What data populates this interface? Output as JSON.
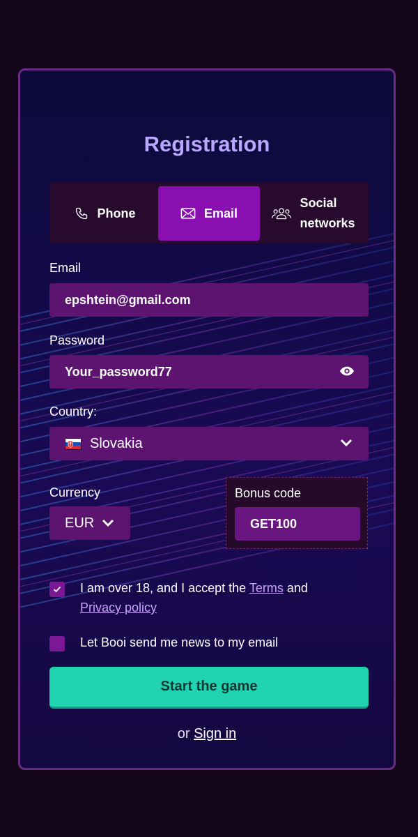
{
  "page": {
    "title": "Registration"
  },
  "tabs": [
    {
      "label": "Phone",
      "icon": "phone-icon",
      "active": false
    },
    {
      "label": "Email",
      "icon": "mail-icon",
      "active": true
    },
    {
      "label_line1": "Social",
      "label_line2": "networks",
      "icon": "users-icon",
      "active": false
    }
  ],
  "email": {
    "label": "Email",
    "value": "epshtein@gmail.com"
  },
  "password": {
    "label": "Password",
    "value": "Your_password77",
    "icon": "eye-icon"
  },
  "country": {
    "label": "Country:",
    "value": "Slovakia",
    "flag": "slovakia-flag"
  },
  "currency": {
    "label": "Currency",
    "value": "EUR"
  },
  "bonus": {
    "label": "Bonus code",
    "value": "GET100"
  },
  "consent": {
    "checked": true,
    "text_before": "I am over 18, and I accept the ",
    "terms_link": "Terms",
    "text_middle": " and",
    "privacy_link": "Privacy policy"
  },
  "newsletter": {
    "checked": false,
    "text": "Let Booi send me news to my email"
  },
  "start_button": {
    "label": "Start the game"
  },
  "signin": {
    "prefix": "or ",
    "link": "Sign in"
  },
  "colors": {
    "accent": "#8a0fb0",
    "field": "#5c1470",
    "button": "#22d3b2",
    "title": "#b9a7ff",
    "link": "#c9a1ff"
  }
}
